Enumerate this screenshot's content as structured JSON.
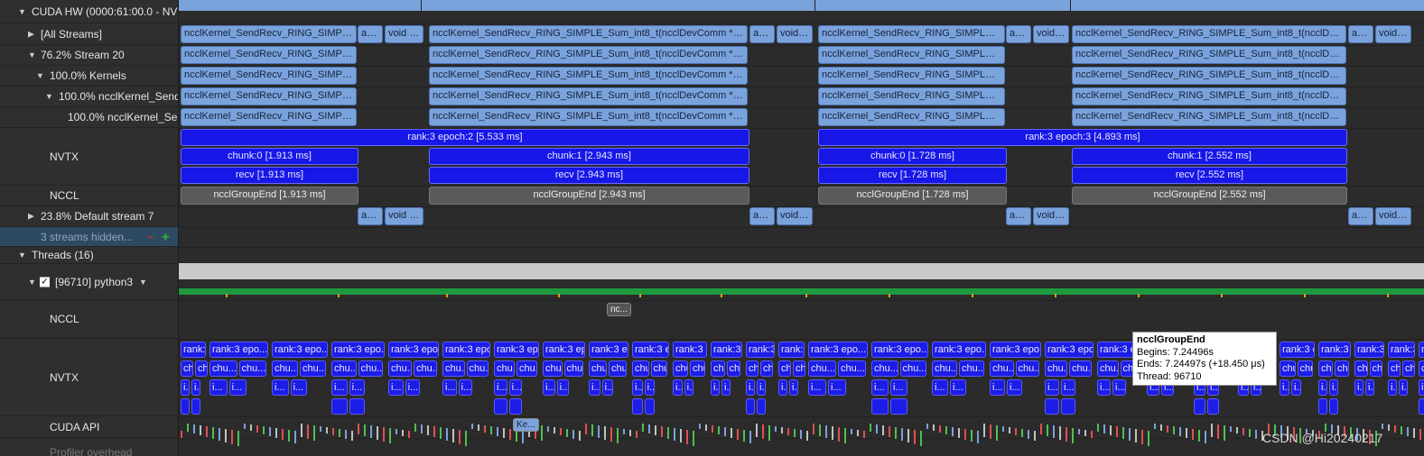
{
  "tree": {
    "cuda_hw": "CUDA HW (0000:61:00.0 - NVI",
    "all_streams": "[All Streams]",
    "stream20": "76.2% Stream 20",
    "kernels": "100.0% Kernels",
    "kernel_send1": "100.0% ncclKernel_Send",
    "kernel_send2": "100.0% ncclKernel_Sen",
    "nvtx": "NVTX",
    "nccl": "NCCL",
    "default_stream": "23.8% Default stream 7",
    "streams_hidden": "3 streams hidden...",
    "threads": "Threads (16)",
    "python_thread": "[96710] python3",
    "thread_nccl": "NCCL",
    "thread_nvtx": "NVTX",
    "cuda_api": "CUDA API",
    "bottom_partial": "Profiler overhead"
  },
  "kernel_labels": {
    "k1": "ncclKernel_SendRecv_RING_SIMPLE_Sum_int8_t(ncclDevComm *, u...",
    "k2": "ncclKernel_SendRecv_RING_SIMPLE_Sum_int8_t(ncclDevComm *, un...",
    "k3": "ncclKernel_SendRecv_RING_SIMPLE_S...",
    "k4": "ncclKernel_SendRecv_RING_SIMPLE_Sum_int8_t(ncclDevC...",
    "am": "am...",
    "void": "void c...",
    "void2": "void ...",
    "void3": "void ..."
  },
  "nvtx": {
    "epoch2": "rank:3 epoch:2 [5.533 ms]",
    "epoch3": "rank:3 epoch:3 [4.893 ms]",
    "chunk0a": "chunk:0 [1.913 ms]",
    "chunk1a": "chunk:1 [2.943 ms]",
    "chunk0b": "chunk:0 [1.728 ms]",
    "chunk1b": "chunk:1 [2.552 ms]",
    "recv_a": "recv [1.913 ms]",
    "recv_b": "recv [2.943 ms]",
    "recv_c": "recv [1.728 ms]",
    "recv_d": "recv [2.552 ms]"
  },
  "nccl": {
    "g1": "ncclGroupEnd [1.913 ms]",
    "g2": "ncclGroupEnd [2.943 ms]",
    "g3": "ncclGroupEnd [1.728 ms]",
    "g4": "ncclGroupEnd [2.552 ms]"
  },
  "thread_nvtx_labels": [
    "rank:3 epo...",
    "rank:3 epoch:1...",
    "chu...",
    "chunk:0 ...",
    "chunk:1 ...",
    "infer ...",
    "fc2...",
    "rec...",
    "i...",
    "ch..."
  ],
  "thread_nccl_label": "nc...",
  "cuda_api_label": "Ke...",
  "tooltip": {
    "title": "ncclGroupEnd",
    "begins": "Begins: 7.24496s",
    "ends": "Ends: 7.24497s (+18.450 μs)",
    "thread": "Thread: 96710"
  },
  "watermark": "CSDN @Hi20240217",
  "colors": {
    "kernel": "#7aa2dc",
    "nvtx": "#1717e8",
    "nccl": "#5a5a5a",
    "green": "#1e9a3e"
  }
}
